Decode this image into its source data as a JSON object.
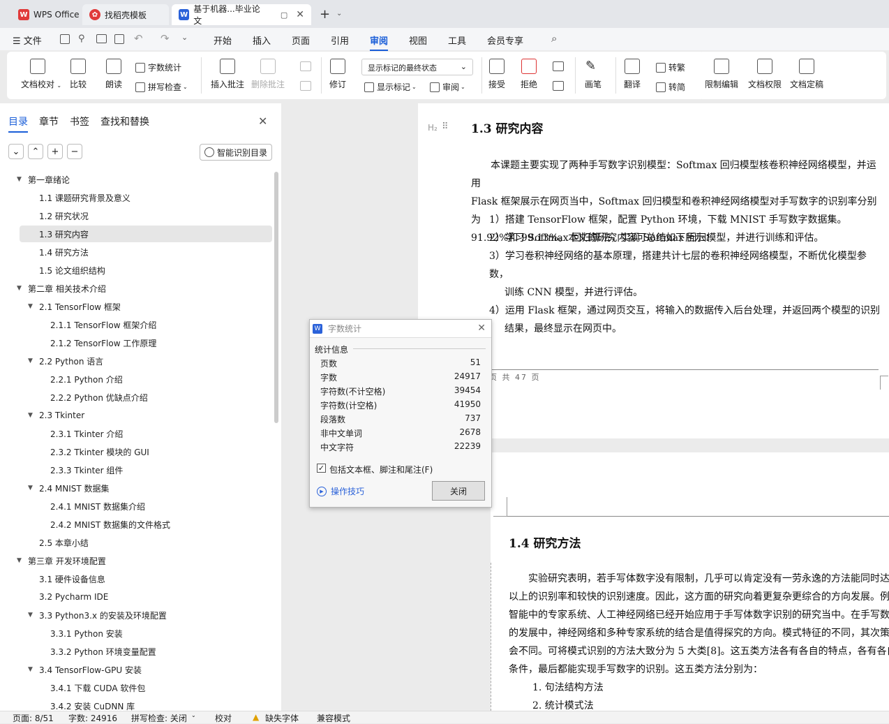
{
  "tabs": [
    {
      "label": "WPS Office"
    },
    {
      "label": "找稻壳模板"
    },
    {
      "label": "基于机器...毕业论文"
    }
  ],
  "menubar": {
    "file": "文件",
    "items": [
      "开始",
      "插入",
      "页面",
      "引用",
      "审阅",
      "视图",
      "工具",
      "会员专享"
    ],
    "active": "审阅"
  },
  "ribbon": {
    "doc_proof": "文档校对",
    "compare": "比较",
    "read_aloud": "朗读",
    "word_count": "字数统计",
    "spell_check": "拼写检查",
    "insert_comment": "插入批注",
    "delete_comment": "删除批注",
    "track": "修订",
    "markup_select": "显示标记的最终状态",
    "show_markup": "显示标记",
    "review": "审阅",
    "accept": "接受",
    "reject": "拒绝",
    "pen": "画笔",
    "translate": "翻译",
    "to_traditional": "转繁",
    "to_simplified": "转简",
    "restrict_edit": "限制编辑",
    "doc_permission": "文档权限",
    "doc_finalize": "文档定稿"
  },
  "sidebar": {
    "tabs": [
      "目录",
      "章节",
      "书签",
      "查找和替换"
    ],
    "smart_toc": "智能识别目录",
    "toc": [
      {
        "label": "第一章绪论",
        "level": 0,
        "arrow": true
      },
      {
        "label": "1.1  课题研究背景及意义",
        "level": 1
      },
      {
        "label": "1.2  研究状况",
        "level": 1
      },
      {
        "label": "1.3  研究内容",
        "level": 1,
        "selected": true
      },
      {
        "label": "1.4  研究方法",
        "level": 1
      },
      {
        "label": "1.5  论文组织结构",
        "level": 1
      },
      {
        "label": "第二章  相关技术介绍",
        "level": 0,
        "arrow": true
      },
      {
        "label": "2.1 TensorFlow 框架",
        "level": 1,
        "arrow": true
      },
      {
        "label": "2.1.1 TensorFlow 框架介绍",
        "level": 2
      },
      {
        "label": "2.1.2 TensorFlow 工作原理",
        "level": 2
      },
      {
        "label": "2.2 Python 语言",
        "level": 1,
        "arrow": true
      },
      {
        "label": "2.2.1 Python 介绍",
        "level": 2
      },
      {
        "label": "2.2.2 Python 优缺点介绍",
        "level": 2
      },
      {
        "label": "2.3 Tkinter",
        "level": 1,
        "arrow": true
      },
      {
        "label": "2.3.1 Tkinter 介绍",
        "level": 2
      },
      {
        "label": "2.3.2 Tkinter 模块的 GUI",
        "level": 2
      },
      {
        "label": "2.3.3 Tkinter 组件",
        "level": 2
      },
      {
        "label": "2.4    MNIST 数据集",
        "level": 1,
        "arrow": true
      },
      {
        "label": "2.4.1 MNIST 数据集介绍",
        "level": 2
      },
      {
        "label": "2.4.2 MNIST 数据集的文件格式",
        "level": 2
      },
      {
        "label": "2.5  本章小结",
        "level": 1
      },
      {
        "label": "第三章  开发环境配置",
        "level": 0,
        "arrow": true
      },
      {
        "label": "3.1  硬件设备信息",
        "level": 1
      },
      {
        "label": "3.2 Pycharm IDE",
        "level": 1
      },
      {
        "label": "3.3 Python3.x 的安装及环境配置",
        "level": 1,
        "arrow": true
      },
      {
        "label": "3.3.1 Python 安装",
        "level": 2
      },
      {
        "label": "3.3.2 Python 环境变量配置",
        "level": 2
      },
      {
        "label": "3.4 TensorFlow-GPU 安装",
        "level": 1,
        "arrow": true
      },
      {
        "label": "3.4.1 下载 CUDA 软件包",
        "level": 2
      },
      {
        "label": "3.4.2 安装 CuDNN 库",
        "level": 2
      }
    ]
  },
  "document": {
    "h_marker": "H₂",
    "section1_title": "1.3  研究内容",
    "section1_para": [
      "本课题主要实现了两种手写数字识别模型：Softmax 回归模型核卷积神经网络模型，并运用",
      "Flask 框架展示在网页当中，Softmax 回归模型和卷积神经网络模型对手写数字的识别率分别为",
      "91.92%和 99.13%。本文的研究内容可总结如下所示："
    ],
    "section1_list": [
      "1）搭建 TensorFlow 框架，配置 Python 环境，下载 MNIST 手写数字数据集。",
      "2）学习 Softmax 回归算法，实现 Softmax 回归模型，并进行训练和评估。",
      "3）学习卷积神经网络的基本原理，搭建共计七层的卷积神经网络模型，不断优化模型参数，",
      "训练 CNN 模型，并进行评估。",
      "4）运用 Flask 框架，通过网页交互，将输入的数据传入后台处理，并返回两个模型的识别",
      "结果，最终显示在网页中。"
    ],
    "footer": "页 共 47 页",
    "section2_title": "1.4  研究方法",
    "section2_para": [
      "实验研究表明，若手写体数字没有限制，几乎可以肯定没有一劳永逸的方法能同时达",
      "以上的识别率和较快的识别速度。因此，这方面的研究向着更复杂更综合的方向发展。例",
      "智能中的专家系统、人工神经网络已经开始应用于手写体数字识别的研究当中。在手写数",
      "的发展中，神经网络和多种专家系统的结合是值得探究的方向。模式特征的不同，其次策",
      "会不同。可将模式识别的方法大致分为 5 大类[8]。这五类方法各有各自的特点，各有各自",
      "条件，最后都能实现手写数字的识别。这五类方法分别为："
    ],
    "section2_list": [
      "1.   句法结构方法",
      "2.   统计模式法"
    ]
  },
  "dialog": {
    "title": "字数统计",
    "group": "统计信息",
    "rows": [
      {
        "label": "页数",
        "value": "51"
      },
      {
        "label": "字数",
        "value": "24917"
      },
      {
        "label": "字符数(不计空格)",
        "value": "39454"
      },
      {
        "label": "字符数(计空格)",
        "value": "41950"
      },
      {
        "label": "段落数",
        "value": "737"
      },
      {
        "label": "非中文单词",
        "value": "2678"
      },
      {
        "label": "中文字符",
        "value": "22239"
      }
    ],
    "checkbox": "包括文本框、脚注和尾注(F)",
    "tips": "操作技巧",
    "close": "关闭"
  },
  "status": {
    "page": "页面: 8/51",
    "words": "字数: 24916",
    "spell": "拼写检查: 关闭",
    "proof": "校对",
    "missing_font": "缺失字体",
    "compat": "兼容模式"
  },
  "colors": {
    "accent": "#1a5ed8",
    "wps_red": "#e03a3a",
    "word_blue": "#2b62d9"
  }
}
